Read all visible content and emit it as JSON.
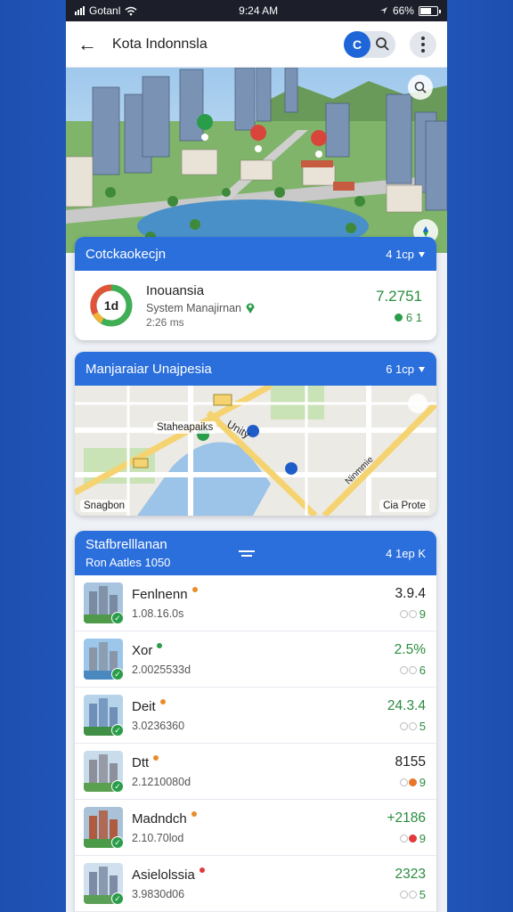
{
  "status": {
    "carrier": "Gotanl",
    "time": "9:24 AM",
    "battery": "66%"
  },
  "appbar": {
    "title": "Kota Indonnsla",
    "toggle_label": "C"
  },
  "stat_card": {
    "header": "Cotckaokecjn",
    "header_meta": "4 1cp",
    "donut_value": "1d",
    "name": "Inouansia",
    "subtitle": "System Manajirnan",
    "time": "2:26 ms",
    "big_value": "7.2751",
    "small_value": "6 1"
  },
  "map_card": {
    "header": "Manjaraiar Unajpesia",
    "header_meta": "6 1cp",
    "labels": {
      "center": "Staheapaiks",
      "north": "Unity",
      "bottom_left": "Snagbon",
      "bottom_right": "Cia Prote",
      "right": "Ninmmie"
    }
  },
  "list_card": {
    "title": "Stafbrelllanan",
    "subtitle": "Ron Aatles 1050",
    "meta": "4 1ep K",
    "rows": [
      {
        "name": "Fenlnenn",
        "sub": "1.08.16.0s",
        "value": "3.9.4",
        "ind": "9",
        "value_color": "#222",
        "dot_color": "#e88d2a",
        "ind_color": "#2a8c3e",
        "extra_color": ""
      },
      {
        "name": "Xor",
        "sub": "2.0025533d",
        "value": "2.5%",
        "ind": "6",
        "value_color": "#2a8c3e",
        "dot_color": "#2a9d4a",
        "ind_color": "#2a8c3e",
        "extra_color": ""
      },
      {
        "name": "Deit",
        "sub": "3.0236360",
        "value": "24.3.4",
        "ind": "5",
        "value_color": "#2a8c3e",
        "dot_color": "#e88d2a",
        "ind_color": "#2a8c3e",
        "extra_color": ""
      },
      {
        "name": "Dtt",
        "sub": "2.1210080d",
        "value": "8155",
        "ind": "9",
        "value_color": "#222",
        "dot_color": "#e88d2a",
        "ind_color": "#2a8c3e",
        "extra_color": "#e8762a"
      },
      {
        "name": "Madndch",
        "sub": "2.10.70lod",
        "value": "+2186",
        "ind": "9",
        "value_color": "#2a8c3e",
        "dot_color": "#e88d2a",
        "ind_color": "#2a8c3e",
        "extra_color": "#e03a3a"
      },
      {
        "name": "Asielolssia",
        "sub": "3.9830d06",
        "value": "2323",
        "ind": "5",
        "value_color": "#2a8c3e",
        "dot_color": "#e03a3a",
        "ind_color": "#2a8c3e",
        "extra_color": ""
      }
    ]
  },
  "colors": {
    "accent": "#2b6fdc",
    "positive": "#2a8c3e",
    "warning": "#e88d2a",
    "danger": "#e03a3a"
  }
}
